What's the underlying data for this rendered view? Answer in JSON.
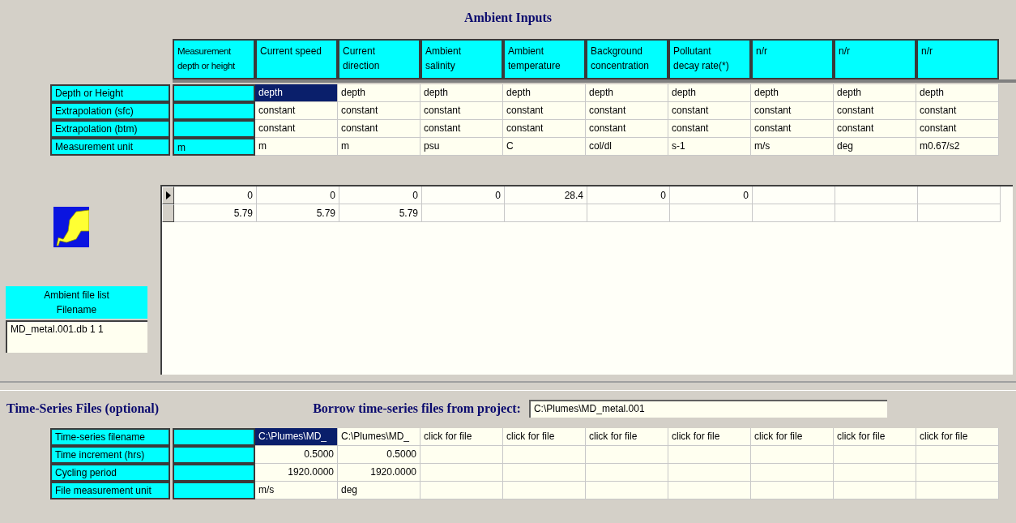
{
  "ambient": {
    "title": "Ambient Inputs",
    "columns": [
      "Measurement depth or height",
      "Current speed",
      "Current direction",
      "Ambient salinity",
      "Ambient temperature",
      "Background concentration",
      "Pollutant decay rate(*)",
      "n/r",
      "n/r",
      "n/r"
    ],
    "attribute_rows": [
      {
        "label": "Depth or Height",
        "cells": [
          {
            "text": "depth",
            "selected": true
          },
          {
            "text": "depth",
            "selected": false
          },
          {
            "text": "depth",
            "selected": false
          },
          {
            "text": "depth",
            "selected": false
          },
          {
            "text": "depth",
            "selected": false
          },
          {
            "text": "depth",
            "selected": false
          },
          {
            "text": "depth",
            "selected": false
          },
          {
            "text": "depth",
            "selected": false
          },
          {
            "text": "depth",
            "selected": false
          }
        ]
      },
      {
        "label": "Extrapolation (sfc)",
        "cells": [
          {
            "text": "constant",
            "selected": false
          },
          {
            "text": "constant",
            "selected": false
          },
          {
            "text": "constant",
            "selected": false
          },
          {
            "text": "constant",
            "selected": false
          },
          {
            "text": "constant",
            "selected": false
          },
          {
            "text": "constant",
            "selected": false
          },
          {
            "text": "constant",
            "selected": false
          },
          {
            "text": "constant",
            "selected": false
          },
          {
            "text": "constant",
            "selected": false
          }
        ]
      },
      {
        "label": "Extrapolation (btm)",
        "cells": [
          {
            "text": "constant",
            "selected": false
          },
          {
            "text": "constant",
            "selected": false
          },
          {
            "text": "constant",
            "selected": false
          },
          {
            "text": "constant",
            "selected": false
          },
          {
            "text": "constant",
            "selected": false
          },
          {
            "text": "constant",
            "selected": false
          },
          {
            "text": "constant",
            "selected": false
          },
          {
            "text": "constant",
            "selected": false
          },
          {
            "text": "constant",
            "selected": false
          }
        ]
      },
      {
        "label": "Measurement unit",
        "depth_column": "m",
        "cells": [
          {
            "text": "m",
            "selected": false
          },
          {
            "text": "m",
            "selected": false
          },
          {
            "text": "psu",
            "selected": false
          },
          {
            "text": "C",
            "selected": false
          },
          {
            "text": "col/dl",
            "selected": false
          },
          {
            "text": "s-1",
            "selected": false
          },
          {
            "text": "m/s",
            "selected": false
          },
          {
            "text": "deg",
            "selected": false
          },
          {
            "text": "m0.67/s2",
            "selected": false
          }
        ]
      }
    ],
    "data_rows": [
      {
        "current": true,
        "values": [
          "0",
          "0",
          "0",
          "0",
          "28.4",
          "0",
          "0"
        ]
      },
      {
        "current": false,
        "values": [
          "5.79",
          "5.79",
          "5.79"
        ]
      }
    ],
    "file_list": {
      "header": [
        "Ambient file list",
        "Filename"
      ],
      "files": [
        "MD_metal.001.db 1 1"
      ]
    }
  },
  "time_series": {
    "title": "Time-Series Files (optional)",
    "borrow_label": "Borrow time-series files from project:",
    "borrow_value": "C:\\Plumes\\MD_metal.001",
    "rows": [
      {
        "label": "Time-series filename",
        "kind": "text",
        "cells": [
          {
            "text": "C:\\Plumes\\MD_",
            "selected": true
          },
          {
            "text": "C:\\Plumes\\MD_",
            "selected": false
          },
          {
            "text": "click for file",
            "selected": false
          },
          {
            "text": "click for file",
            "selected": false
          },
          {
            "text": "click for file",
            "selected": false
          },
          {
            "text": "click for file",
            "selected": false
          },
          {
            "text": "click for file",
            "selected": false
          },
          {
            "text": "click for file",
            "selected": false
          },
          {
            "text": "click for file",
            "selected": false
          }
        ]
      },
      {
        "label": "Time increment (hrs)",
        "kind": "number",
        "cells": [
          {
            "text": "0.5000",
            "selected": false
          },
          {
            "text": "0.5000",
            "selected": false
          },
          {
            "selected": false
          },
          {
            "selected": false
          },
          {
            "selected": false
          },
          {
            "selected": false
          },
          {
            "selected": false
          },
          {
            "selected": false
          },
          {
            "selected": false
          }
        ]
      },
      {
        "label": "Cycling period",
        "kind": "number",
        "cells": [
          {
            "text": "1920.0000",
            "selected": false
          },
          {
            "text": "1920.0000",
            "selected": false
          },
          {
            "selected": false
          },
          {
            "selected": false
          },
          {
            "selected": false
          },
          {
            "selected": false
          },
          {
            "selected": false
          },
          {
            "selected": false
          },
          {
            "selected": false
          }
        ]
      },
      {
        "label": "File measurement unit",
        "kind": "text",
        "cells": [
          {
            "text": "m/s",
            "selected": false
          },
          {
            "text": "deg",
            "selected": false
          },
          {
            "selected": false
          },
          {
            "selected": false
          },
          {
            "selected": false
          },
          {
            "selected": false
          },
          {
            "selected": false
          },
          {
            "selected": false
          },
          {
            "selected": false
          }
        ]
      }
    ]
  }
}
